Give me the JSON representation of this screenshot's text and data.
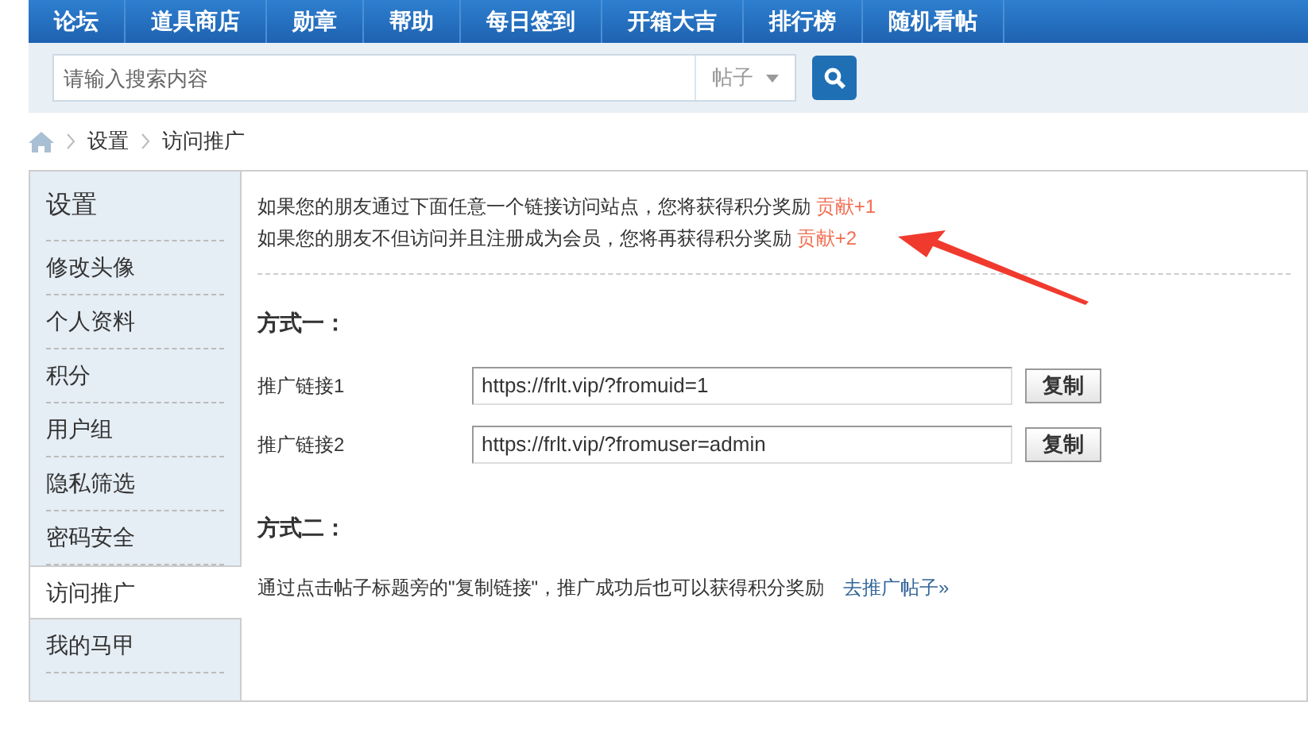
{
  "nav": [
    {
      "label": "论坛"
    },
    {
      "label": "道具商店"
    },
    {
      "label": "勋章"
    },
    {
      "label": "帮助"
    },
    {
      "label": "每日签到"
    },
    {
      "label": "开箱大吉"
    },
    {
      "label": "排行榜"
    },
    {
      "label": "随机看帖"
    }
  ],
  "search": {
    "placeholder": "请输入搜索内容",
    "scope": "帖子"
  },
  "breadcrumb": [
    "设置",
    "访问推广"
  ],
  "sidebar": {
    "title": "设置",
    "items": [
      {
        "label": "修改头像",
        "selected": false
      },
      {
        "label": "个人资料",
        "selected": false
      },
      {
        "label": "积分",
        "selected": false
      },
      {
        "label": "用户组",
        "selected": false
      },
      {
        "label": "隐私筛选",
        "selected": false
      },
      {
        "label": "密码安全",
        "selected": false
      },
      {
        "label": "访问推广",
        "selected": true
      },
      {
        "label": "我的马甲",
        "selected": false
      }
    ]
  },
  "intro": [
    {
      "text": "如果您的朋友通过下面任意一个链接访问站点，您将获得积分奖励",
      "reward": "贡献+1"
    },
    {
      "text": "如果您的朋友不但访问并且注册成为会员，您将再获得积分奖励",
      "reward": "贡献+2"
    }
  ],
  "method1": {
    "title": "方式一：",
    "links": [
      {
        "label": "推广链接1",
        "value": "https://frlt.vip/?fromuid=1",
        "button": "复制"
      },
      {
        "label": "推广链接2",
        "value": "https://frlt.vip/?fromuser=admin",
        "button": "复制"
      }
    ]
  },
  "method2": {
    "title": "方式二：",
    "text": "通过点击帖子标题旁的\"复制链接\"，推广成功后也可以获得积分奖励",
    "link": "去推广帖子»"
  }
}
